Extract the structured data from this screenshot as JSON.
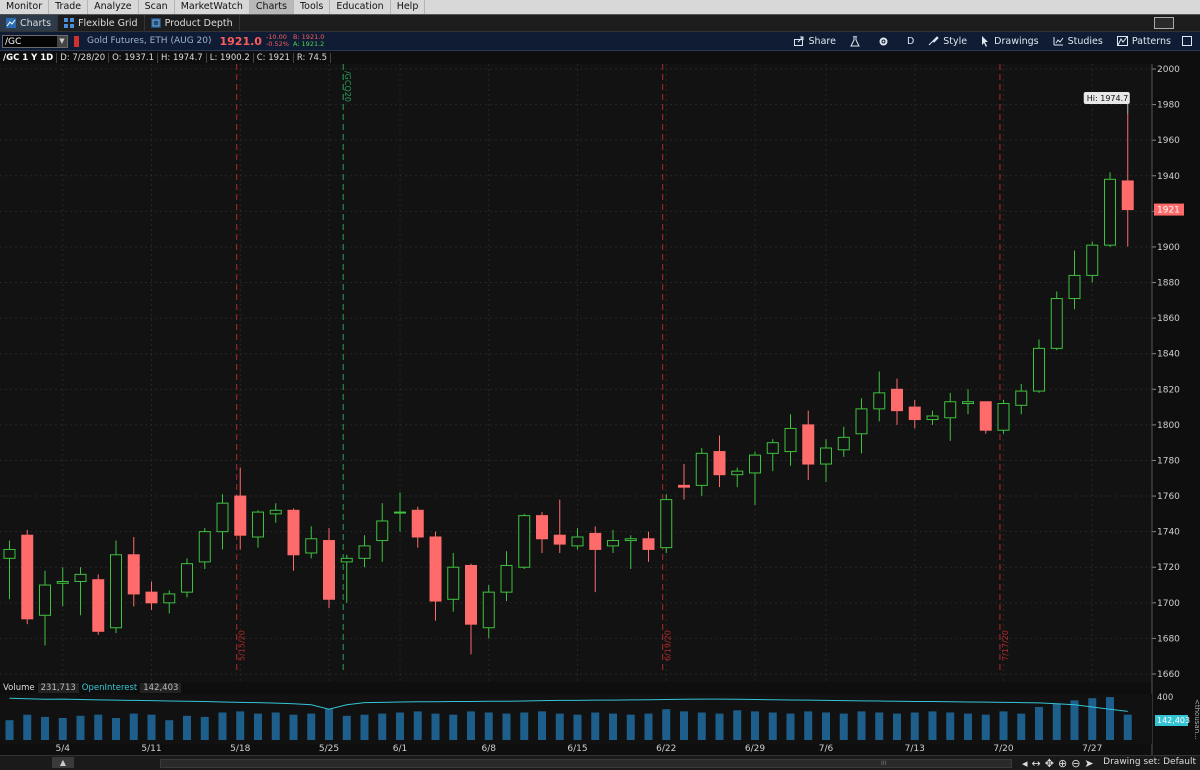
{
  "menu": [
    "Monitor",
    "Trade",
    "Analyze",
    "Scan",
    "MarketWatch",
    "Charts",
    "Tools",
    "Education",
    "Help"
  ],
  "menu_active": "Charts",
  "tabs": [
    {
      "label": "Charts",
      "active": true
    },
    {
      "label": "Flexible Grid",
      "active": false
    },
    {
      "label": "Product Depth",
      "active": false
    }
  ],
  "toolbar": {
    "symbol": "/GC",
    "description": "Gold Futures, ETH (AUG 20)",
    "last": "1921.0",
    "change": "-10.00",
    "change_pct": "-0.52%",
    "bid": "B: 1921.0",
    "ask": "A: 1921.2",
    "buttons": [
      "Share",
      "D",
      "Style",
      "Drawings",
      "Studies",
      "Patterns"
    ]
  },
  "info": {
    "symbol_period": "/GC 1 Y 1D",
    "date": "D: 7/28/20",
    "open": "O: 1937.1",
    "high": "H: 1974.7",
    "low": "L: 1900.2",
    "close": "C: 1921",
    "range": "R: 74.5"
  },
  "volume_bar": {
    "volume_label": "Volume",
    "volume_value": "231,713",
    "oi_label": "OpenInterest",
    "oi_value": "142,403",
    "scale_top": "400",
    "oi_badge": "142,403",
    "side_label": "<thousan..."
  },
  "bottom": {
    "drawing_set": "Drawing set: Default",
    "scroll_grip": "III"
  },
  "colors": {
    "up": "#3ec13e",
    "down": "#ff6a6a",
    "oi": "#32c4d4",
    "volume": "#1d5f8a",
    "event_red": "#b02a2a",
    "event_green": "#2aa05a"
  },
  "chart_data": {
    "type": "candlestick",
    "ylim": [
      1660,
      2000
    ],
    "y_ticks": [
      1660,
      1680,
      1700,
      1720,
      1740,
      1760,
      1780,
      1800,
      1820,
      1840,
      1860,
      1880,
      1900,
      1920,
      1940,
      1960,
      1980,
      2000
    ],
    "x_labels": [
      {
        "label": "5/4",
        "index": 3
      },
      {
        "label": "5/11",
        "index": 8
      },
      {
        "label": "5/18",
        "index": 13
      },
      {
        "label": "5/25",
        "index": 18
      },
      {
        "label": "6/1",
        "index": 22
      },
      {
        "label": "6/8",
        "index": 27
      },
      {
        "label": "6/15",
        "index": 32
      },
      {
        "label": "6/22",
        "index": 37
      },
      {
        "label": "6/29",
        "index": 42
      },
      {
        "label": "7/6",
        "index": 46
      },
      {
        "label": "7/13",
        "index": 51
      },
      {
        "label": "7/20",
        "index": 56
      },
      {
        "label": "7/27",
        "index": 61
      }
    ],
    "event_lines": [
      {
        "index": 12.8,
        "label": "5/15/20",
        "color": "red"
      },
      {
        "index": 18.8,
        "label": "/GCQ20",
        "color": "green"
      },
      {
        "index": 36.8,
        "label": "6/19/20",
        "color": "red"
      },
      {
        "index": 55.8,
        "label": "7/17/20",
        "color": "red"
      }
    ],
    "hi_label": "Hi: 1974.7",
    "last_price_label": "1921",
    "candles": [
      {
        "o": 1725,
        "h": 1735,
        "l": 1702,
        "c": 1730
      },
      {
        "o": 1738,
        "h": 1741,
        "l": 1688,
        "c": 1691
      },
      {
        "o": 1693,
        "h": 1718,
        "l": 1676,
        "c": 1710
      },
      {
        "o": 1711,
        "h": 1720,
        "l": 1698,
        "c": 1712
      },
      {
        "o": 1712,
        "h": 1720,
        "l": 1693,
        "c": 1716
      },
      {
        "o": 1713,
        "h": 1716,
        "l": 1682,
        "c": 1684
      },
      {
        "o": 1686,
        "h": 1735,
        "l": 1683,
        "c": 1727
      },
      {
        "o": 1727,
        "h": 1737,
        "l": 1698,
        "c": 1705
      },
      {
        "o": 1706,
        "h": 1712,
        "l": 1696,
        "c": 1700
      },
      {
        "o": 1700,
        "h": 1707,
        "l": 1694,
        "c": 1705
      },
      {
        "o": 1706,
        "h": 1725,
        "l": 1703,
        "c": 1722
      },
      {
        "o": 1723,
        "h": 1742,
        "l": 1719,
        "c": 1740
      },
      {
        "o": 1740,
        "h": 1761,
        "l": 1730,
        "c": 1756
      },
      {
        "o": 1760,
        "h": 1776,
        "l": 1730,
        "c": 1738
      },
      {
        "o": 1737,
        "h": 1752,
        "l": 1731,
        "c": 1751
      },
      {
        "o": 1750,
        "h": 1756,
        "l": 1745,
        "c": 1752
      },
      {
        "o": 1752,
        "h": 1753,
        "l": 1718,
        "c": 1727
      },
      {
        "o": 1728,
        "h": 1743,
        "l": 1725,
        "c": 1736
      },
      {
        "o": 1735,
        "h": 1742,
        "l": 1697,
        "c": 1702
      },
      {
        "o": 1723,
        "h": 1727,
        "l": 1700,
        "c": 1725
      },
      {
        "o": 1725,
        "h": 1738,
        "l": 1720,
        "c": 1732
      },
      {
        "o": 1735,
        "h": 1756,
        "l": 1723,
        "c": 1746
      },
      {
        "o": 1751,
        "h": 1762,
        "l": 1740,
        "c": 1751
      },
      {
        "o": 1752,
        "h": 1754,
        "l": 1731,
        "c": 1737
      },
      {
        "o": 1737,
        "h": 1740,
        "l": 1690,
        "c": 1701
      },
      {
        "o": 1702,
        "h": 1728,
        "l": 1695,
        "c": 1720
      },
      {
        "o": 1721,
        "h": 1722,
        "l": 1671,
        "c": 1688
      },
      {
        "o": 1686,
        "h": 1710,
        "l": 1680,
        "c": 1706
      },
      {
        "o": 1706,
        "h": 1729,
        "l": 1701,
        "c": 1721
      },
      {
        "o": 1720,
        "h": 1750,
        "l": 1719,
        "c": 1749
      },
      {
        "o": 1749,
        "h": 1751,
        "l": 1728,
        "c": 1736
      },
      {
        "o": 1738,
        "h": 1758,
        "l": 1728,
        "c": 1733
      },
      {
        "o": 1732,
        "h": 1742,
        "l": 1730,
        "c": 1737
      },
      {
        "o": 1739,
        "h": 1743,
        "l": 1706,
        "c": 1730
      },
      {
        "o": 1732,
        "h": 1741,
        "l": 1728,
        "c": 1735
      },
      {
        "o": 1735,
        "h": 1738,
        "l": 1719,
        "c": 1736
      },
      {
        "o": 1736,
        "h": 1740,
        "l": 1723,
        "c": 1730
      },
      {
        "o": 1731,
        "h": 1761,
        "l": 1728,
        "c": 1758
      },
      {
        "o": 1766,
        "h": 1778,
        "l": 1758,
        "c": 1765
      },
      {
        "o": 1766,
        "h": 1787,
        "l": 1760,
        "c": 1784
      },
      {
        "o": 1785,
        "h": 1794,
        "l": 1765,
        "c": 1772
      },
      {
        "o": 1772,
        "h": 1776,
        "l": 1765,
        "c": 1774
      },
      {
        "o": 1773,
        "h": 1785,
        "l": 1755,
        "c": 1783
      },
      {
        "o": 1784,
        "h": 1792,
        "l": 1774,
        "c": 1790
      },
      {
        "o": 1785,
        "h": 1806,
        "l": 1777,
        "c": 1798
      },
      {
        "o": 1800,
        "h": 1808,
        "l": 1769,
        "c": 1778
      },
      {
        "o": 1778,
        "h": 1792,
        "l": 1768,
        "c": 1787
      },
      {
        "o": 1786,
        "h": 1799,
        "l": 1782,
        "c": 1793
      },
      {
        "o": 1795,
        "h": 1815,
        "l": 1784,
        "c": 1809
      },
      {
        "o": 1809,
        "h": 1830,
        "l": 1802,
        "c": 1818
      },
      {
        "o": 1820,
        "h": 1826,
        "l": 1800,
        "c": 1808
      },
      {
        "o": 1810,
        "h": 1814,
        "l": 1798,
        "c": 1803
      },
      {
        "o": 1803,
        "h": 1808,
        "l": 1800,
        "c": 1805
      },
      {
        "o": 1804,
        "h": 1818,
        "l": 1791,
        "c": 1813
      },
      {
        "o": 1812,
        "h": 1820,
        "l": 1806,
        "c": 1813
      },
      {
        "o": 1813,
        "h": 1813,
        "l": 1795,
        "c": 1797
      },
      {
        "o": 1797,
        "h": 1814,
        "l": 1795,
        "c": 1812
      },
      {
        "o": 1811,
        "h": 1823,
        "l": 1806,
        "c": 1819
      },
      {
        "o": 1819,
        "h": 1848,
        "l": 1818,
        "c": 1843
      },
      {
        "o": 1843,
        "h": 1875,
        "l": 1842,
        "c": 1871
      },
      {
        "o": 1871,
        "h": 1898,
        "l": 1865,
        "c": 1884
      },
      {
        "o": 1884,
        "h": 1903,
        "l": 1880,
        "c": 1901
      },
      {
        "o": 1901,
        "h": 1942,
        "l": 1900,
        "c": 1938
      },
      {
        "o": 1937.1,
        "h": 1974.7,
        "l": 1900.2,
        "c": 1921
      }
    ],
    "volume": [
      180,
      230,
      210,
      200,
      220,
      230,
      200,
      240,
      230,
      180,
      220,
      210,
      250,
      260,
      240,
      250,
      230,
      240,
      280,
      220,
      230,
      240,
      250,
      260,
      240,
      230,
      260,
      250,
      240,
      250,
      260,
      240,
      230,
      250,
      240,
      230,
      240,
      280,
      260,
      250,
      240,
      270,
      260,
      250,
      240,
      260,
      250,
      240,
      260,
      250,
      240,
      250,
      260,
      250,
      240,
      230,
      260,
      240,
      300,
      330,
      360,
      380,
      390,
      230
    ],
    "open_interest": [
      380,
      375,
      370,
      372,
      368,
      365,
      362,
      360,
      358,
      355,
      352,
      350,
      345,
      342,
      340,
      335,
      330,
      320,
      280,
      320,
      340,
      342,
      345,
      348,
      348,
      350,
      350,
      352,
      352,
      355,
      358,
      360,
      360,
      362,
      362,
      365,
      366,
      368,
      370,
      372,
      372,
      370,
      368,
      366,
      364,
      362,
      360,
      358,
      356,
      354,
      352,
      350,
      350,
      348,
      346,
      344,
      342,
      340,
      338,
      330,
      320,
      300,
      280,
      260
    ],
    "volume_max": 400
  }
}
